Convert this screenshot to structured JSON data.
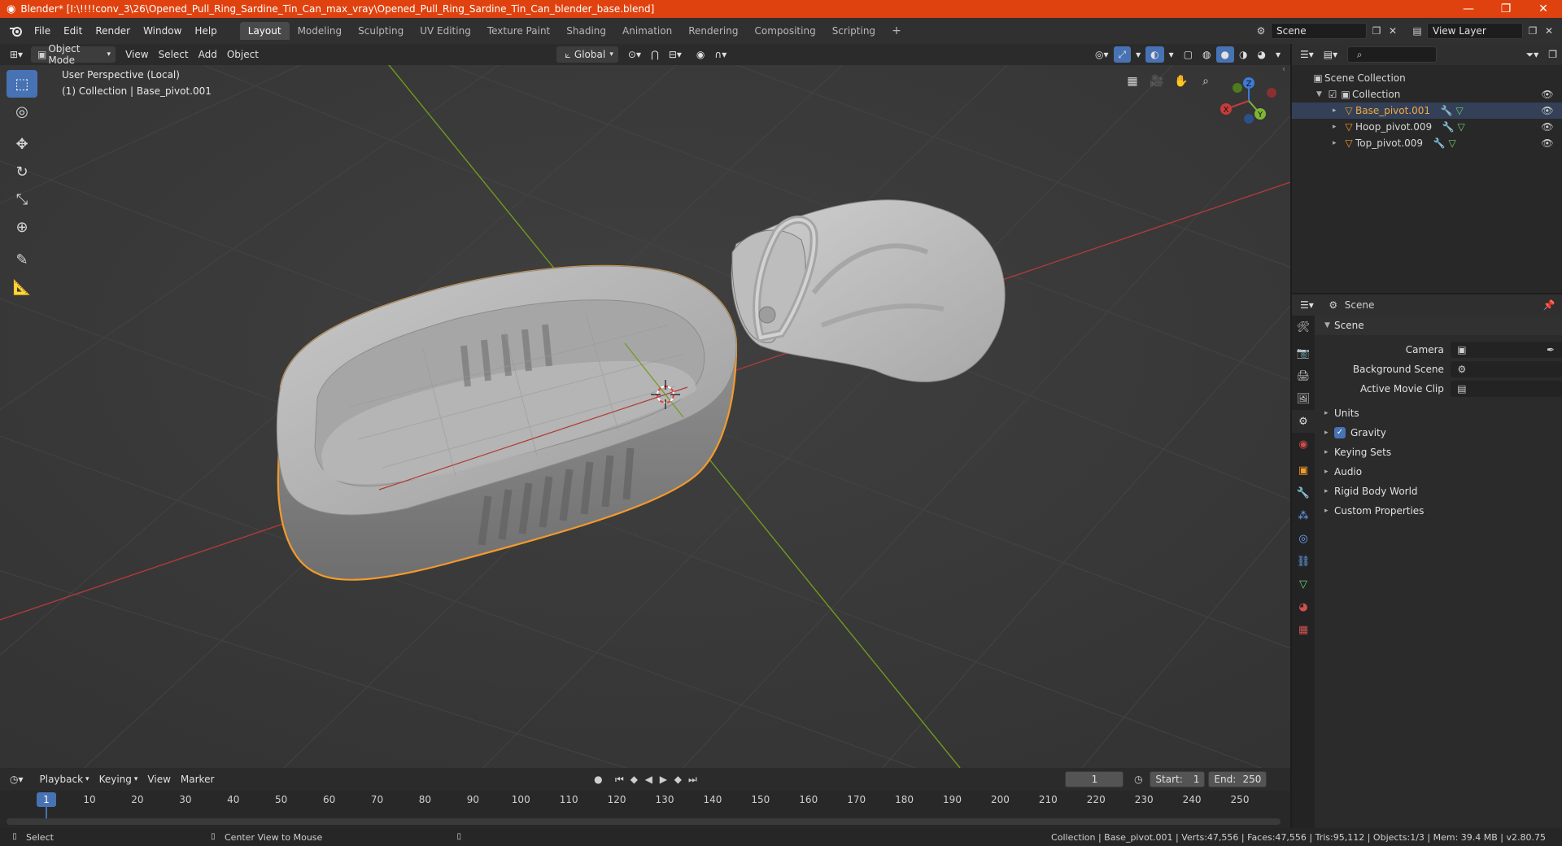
{
  "titlebar": {
    "title": "Blender* [I:\\!!!!conv_3\\26\\Opened_Pull_Ring_Sardine_Tin_Can_max_vray\\Opened_Pull_Ring_Sardine_Tin_Can_blender_base.blend]",
    "minimize": "—",
    "maximize": "❐",
    "close": "✕"
  },
  "menu": [
    "File",
    "Edit",
    "Render",
    "Window",
    "Help"
  ],
  "workspaces": [
    "Layout",
    "Modeling",
    "Sculpting",
    "UV Editing",
    "Texture Paint",
    "Shading",
    "Animation",
    "Rendering",
    "Compositing",
    "Scripting"
  ],
  "scene_field": "Scene",
  "view_layer_field": "View Layer",
  "viewport_header": {
    "mode": "Object Mode",
    "view": "View",
    "select": "Select",
    "add": "Add",
    "object": "Object",
    "orientation": "Global"
  },
  "viewport_info": {
    "line1": "User Perspective (Local)",
    "line2": "(1) Collection | Base_pivot.001"
  },
  "gizmo": {
    "x": "X",
    "y": "Y",
    "z": "Z"
  },
  "timeline": {
    "playback": "Playback",
    "keying": "Keying",
    "view": "View",
    "marker": "Marker",
    "current_frame": "1",
    "start_label": "Start:",
    "start": "1",
    "end_label": "End:",
    "end": "250",
    "ticks": [
      "1",
      "10",
      "20",
      "30",
      "40",
      "50",
      "60",
      "70",
      "80",
      "90",
      "100",
      "110",
      "120",
      "130",
      "140",
      "150",
      "160",
      "170",
      "180",
      "190",
      "200",
      "210",
      "220",
      "230",
      "240",
      "250"
    ]
  },
  "status": {
    "left1": "Select",
    "left2": "Center View to Mouse",
    "right": "Collection | Base_pivot.001 | Verts:47,556 | Faces:47,556 | Tris:95,112 | Objects:1/3 | Mem: 39.4 MB | v2.80.75"
  },
  "outliner": {
    "scene_collection": "Scene Collection",
    "collection": "Collection",
    "items": [
      {
        "name": "Base_pivot.001",
        "selected": true
      },
      {
        "name": "Hoop_pivot.009",
        "selected": false
      },
      {
        "name": "Top_pivot.009",
        "selected": false
      }
    ]
  },
  "properties": {
    "header": "Scene",
    "panel": "Scene",
    "camera_label": "Camera",
    "background_label": "Background Scene",
    "movieclip_label": "Active Movie Clip",
    "subpanels": [
      "Units",
      "Gravity",
      "Keying Sets",
      "Audio",
      "Rigid Body World",
      "Custom Properties"
    ]
  },
  "colors": {
    "title_bg": "#e0420f",
    "active_blue": "#4772b3",
    "selection_orange": "#f39a2b",
    "x_axis": "#b03a3a",
    "y_axis": "#6f9a1c"
  }
}
